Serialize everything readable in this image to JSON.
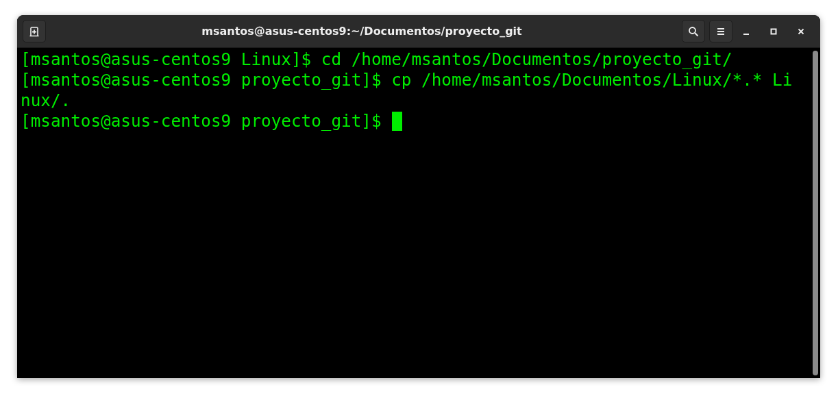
{
  "window": {
    "title": "msantos@asus-centos9:~/Documentos/proyecto_git"
  },
  "terminal": {
    "lines": [
      {
        "text": "[msantos@asus-centos9 Linux]$ cd /home/msantos/Documentos/proyecto_git/",
        "cursor": false
      },
      {
        "text": "[msantos@asus-centos9 proyecto_git]$ cp /home/msantos/Documentos/Linux/*.* Li",
        "cursor": false
      },
      {
        "text": "nux/.",
        "cursor": false
      },
      {
        "text": "[msantos@asus-centos9 proyecto_git]$",
        "cursor": true
      }
    ]
  }
}
